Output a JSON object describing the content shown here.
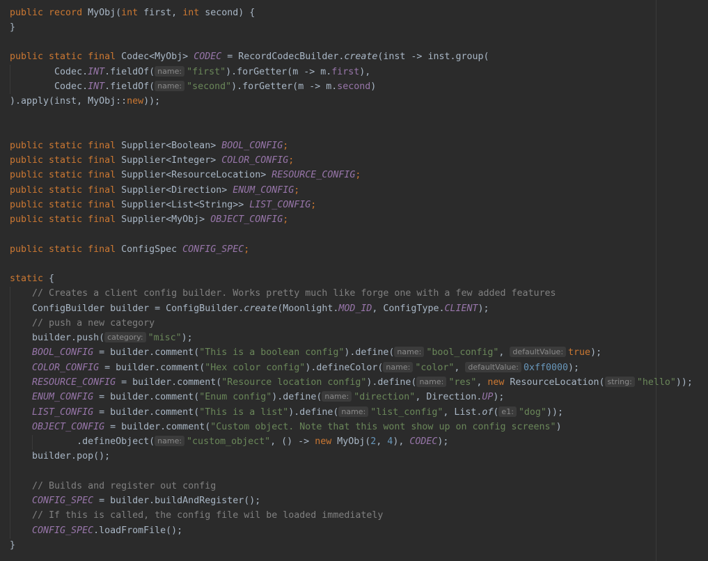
{
  "lines": [
    [
      {
        "t": "public record ",
        "c": "kw"
      },
      {
        "t": "MyObj(",
        "c": "plain"
      },
      {
        "t": "int ",
        "c": "kw"
      },
      {
        "t": "first, ",
        "c": "plain"
      },
      {
        "t": "int ",
        "c": "kw"
      },
      {
        "t": "second) {",
        "c": "plain"
      }
    ],
    [
      {
        "t": "}",
        "c": "plain"
      }
    ],
    [],
    [
      {
        "t": "public static final ",
        "c": "kw"
      },
      {
        "t": "Codec<MyObj> ",
        "c": "plain"
      },
      {
        "t": "CODEC",
        "c": "fld"
      },
      {
        "t": " = RecordCodecBuilder.",
        "c": "plain"
      },
      {
        "t": "create",
        "c": "mth"
      },
      {
        "t": "(inst -> inst.group(",
        "c": "plain"
      }
    ],
    [
      {
        "t": "        Codec.",
        "c": "plain"
      },
      {
        "t": "INT",
        "c": "fld"
      },
      {
        "t": ".fieldOf(",
        "c": "plain"
      },
      {
        "h": "name:"
      },
      {
        "t": "\"first\"",
        "c": "str"
      },
      {
        "t": ").forGetter(m -> m.",
        "c": "plain"
      },
      {
        "t": "first",
        "c": "mem"
      },
      {
        "t": "),",
        "c": "plain"
      }
    ],
    [
      {
        "t": "        Codec.",
        "c": "plain"
      },
      {
        "t": "INT",
        "c": "fld"
      },
      {
        "t": ".fieldOf(",
        "c": "plain"
      },
      {
        "h": "name:"
      },
      {
        "t": "\"second\"",
        "c": "str"
      },
      {
        "t": ").forGetter(m -> m.",
        "c": "plain"
      },
      {
        "t": "second",
        "c": "mem"
      },
      {
        "t": ")",
        "c": "plain"
      }
    ],
    [
      {
        "t": ").apply(inst, MyObj::",
        "c": "plain"
      },
      {
        "t": "new",
        "c": "kw"
      },
      {
        "t": "));",
        "c": "plain"
      }
    ],
    [],
    [],
    [
      {
        "t": "public static final ",
        "c": "kw"
      },
      {
        "t": "Supplier<Boolean> ",
        "c": "plain"
      },
      {
        "t": "BOOL_CONFIG",
        "c": "fld"
      },
      {
        "t": ";",
        "c": "kw"
      }
    ],
    [
      {
        "t": "public static final ",
        "c": "kw"
      },
      {
        "t": "Supplier<Integer> ",
        "c": "plain"
      },
      {
        "t": "COLOR_CONFIG",
        "c": "fld"
      },
      {
        "t": ";",
        "c": "kw"
      }
    ],
    [
      {
        "t": "public static final ",
        "c": "kw"
      },
      {
        "t": "Supplier<ResourceLocation> ",
        "c": "plain"
      },
      {
        "t": "RESOURCE_CONFIG",
        "c": "fld"
      },
      {
        "t": ";",
        "c": "kw"
      }
    ],
    [
      {
        "t": "public static final ",
        "c": "kw"
      },
      {
        "t": "Supplier<Direction> ",
        "c": "plain"
      },
      {
        "t": "ENUM_CONFIG",
        "c": "fld"
      },
      {
        "t": ";",
        "c": "kw"
      }
    ],
    [
      {
        "t": "public static final ",
        "c": "kw"
      },
      {
        "t": "Supplier<List<String>> ",
        "c": "plain"
      },
      {
        "t": "LIST_CONFIG",
        "c": "fld"
      },
      {
        "t": ";",
        "c": "kw"
      }
    ],
    [
      {
        "t": "public static final ",
        "c": "kw"
      },
      {
        "t": "Supplier<MyObj> ",
        "c": "plain"
      },
      {
        "t": "OBJECT_CONFIG",
        "c": "fld"
      },
      {
        "t": ";",
        "c": "kw"
      }
    ],
    [],
    [
      {
        "t": "public static final ",
        "c": "kw"
      },
      {
        "t": "ConfigSpec ",
        "c": "plain"
      },
      {
        "t": "CONFIG_SPEC",
        "c": "fld"
      },
      {
        "t": ";",
        "c": "kw"
      }
    ],
    [],
    [
      {
        "t": "static ",
        "c": "kw"
      },
      {
        "t": "{",
        "c": "plain"
      }
    ],
    [
      {
        "t": "    // Creates a client config builder. Works pretty much like forge one with a few added features",
        "c": "cmt"
      }
    ],
    [
      {
        "t": "    ConfigBuilder builder = ConfigBuilder.",
        "c": "plain"
      },
      {
        "t": "create",
        "c": "mth"
      },
      {
        "t": "(Moonlight.",
        "c": "plain"
      },
      {
        "t": "MOD_ID",
        "c": "fld"
      },
      {
        "t": ", ConfigType.",
        "c": "plain"
      },
      {
        "t": "CLIENT",
        "c": "fld"
      },
      {
        "t": ");",
        "c": "plain"
      }
    ],
    [
      {
        "t": "    // push a new category",
        "c": "cmt"
      }
    ],
    [
      {
        "t": "    builder.push(",
        "c": "plain"
      },
      {
        "h": "category:"
      },
      {
        "t": "\"misc\"",
        "c": "str"
      },
      {
        "t": ");",
        "c": "plain"
      }
    ],
    [
      {
        "t": "    ",
        "c": "plain"
      },
      {
        "t": "BOOL_CONFIG",
        "c": "fld"
      },
      {
        "t": " = builder.comment(",
        "c": "plain"
      },
      {
        "t": "\"This is a boolean config\"",
        "c": "str"
      },
      {
        "t": ").define(",
        "c": "plain"
      },
      {
        "h": "name:"
      },
      {
        "t": "\"bool_config\"",
        "c": "str"
      },
      {
        "t": ", ",
        "c": "plain"
      },
      {
        "h": "defaultValue:"
      },
      {
        "t": "true",
        "c": "kw"
      },
      {
        "t": ");",
        "c": "plain"
      }
    ],
    [
      {
        "t": "    ",
        "c": "plain"
      },
      {
        "t": "COLOR_CONFIG",
        "c": "fld"
      },
      {
        "t": " = builder.comment(",
        "c": "plain"
      },
      {
        "t": "\"Hex color config\"",
        "c": "str"
      },
      {
        "t": ").defineColor(",
        "c": "plain"
      },
      {
        "h": "name:"
      },
      {
        "t": "\"color\"",
        "c": "str"
      },
      {
        "t": ", ",
        "c": "plain"
      },
      {
        "h": "defaultValue:"
      },
      {
        "t": "0xff0000",
        "c": "num"
      },
      {
        "t": ");",
        "c": "plain"
      }
    ],
    [
      {
        "t": "    ",
        "c": "plain"
      },
      {
        "t": "RESOURCE_CONFIG",
        "c": "fld"
      },
      {
        "t": " = builder.comment(",
        "c": "plain"
      },
      {
        "t": "\"Resource location config\"",
        "c": "str"
      },
      {
        "t": ").define(",
        "c": "plain"
      },
      {
        "h": "name:"
      },
      {
        "t": "\"res\"",
        "c": "str"
      },
      {
        "t": ", ",
        "c": "plain"
      },
      {
        "t": "new ",
        "c": "kw"
      },
      {
        "t": "ResourceLocation(",
        "c": "plain"
      },
      {
        "h": "string:"
      },
      {
        "t": "\"hello\"",
        "c": "str"
      },
      {
        "t": "));",
        "c": "plain"
      }
    ],
    [
      {
        "t": "    ",
        "c": "plain"
      },
      {
        "t": "ENUM_CONFIG",
        "c": "fld"
      },
      {
        "t": " = builder.comment(",
        "c": "plain"
      },
      {
        "t": "\"Enum config\"",
        "c": "str"
      },
      {
        "t": ").define(",
        "c": "plain"
      },
      {
        "h": "name:"
      },
      {
        "t": "\"direction\"",
        "c": "str"
      },
      {
        "t": ", Direction.",
        "c": "plain"
      },
      {
        "t": "UP",
        "c": "fld"
      },
      {
        "t": ");",
        "c": "plain"
      }
    ],
    [
      {
        "t": "    ",
        "c": "plain"
      },
      {
        "t": "LIST_CONFIG",
        "c": "fld"
      },
      {
        "t": " = builder.comment(",
        "c": "plain"
      },
      {
        "t": "\"This is a list\"",
        "c": "str"
      },
      {
        "t": ").define(",
        "c": "plain"
      },
      {
        "h": "name:"
      },
      {
        "t": "\"list_config\"",
        "c": "str"
      },
      {
        "t": ", List.",
        "c": "plain"
      },
      {
        "t": "of",
        "c": "mth"
      },
      {
        "t": "(",
        "c": "plain"
      },
      {
        "h": "e1:"
      },
      {
        "t": "\"dog\"",
        "c": "str"
      },
      {
        "t": "));",
        "c": "plain"
      }
    ],
    [
      {
        "t": "    ",
        "c": "plain"
      },
      {
        "t": "OBJECT_CONFIG",
        "c": "fld"
      },
      {
        "t": " = builder.comment(",
        "c": "plain"
      },
      {
        "t": "\"Custom object. Note that this wont show up on config screens\"",
        "c": "str"
      },
      {
        "t": ")",
        "c": "plain"
      }
    ],
    [
      {
        "t": "            .defineObject(",
        "c": "plain"
      },
      {
        "h": "name:"
      },
      {
        "t": "\"custom_object\"",
        "c": "str"
      },
      {
        "t": ", () -> ",
        "c": "plain"
      },
      {
        "t": "new ",
        "c": "kw"
      },
      {
        "t": "MyObj(",
        "c": "plain"
      },
      {
        "t": "2",
        "c": "num"
      },
      {
        "t": ", ",
        "c": "plain"
      },
      {
        "t": "4",
        "c": "num"
      },
      {
        "t": "), ",
        "c": "plain"
      },
      {
        "t": "CODEC",
        "c": "fld"
      },
      {
        "t": ");",
        "c": "plain"
      }
    ],
    [
      {
        "t": "    builder.pop();",
        "c": "plain"
      }
    ],
    [],
    [
      {
        "t": "    // Builds and register out config",
        "c": "cmt"
      }
    ],
    [
      {
        "t": "    ",
        "c": "plain"
      },
      {
        "t": "CONFIG_SPEC",
        "c": "fld"
      },
      {
        "t": " = builder.buildAndRegister();",
        "c": "plain"
      }
    ],
    [
      {
        "t": "    // If this is called, the config file wil be loaded immediately",
        "c": "cmt"
      }
    ],
    [
      {
        "t": "    ",
        "c": "plain"
      },
      {
        "t": "CONFIG_SPEC",
        "c": "fld"
      },
      {
        "t": ".loadFromFile();",
        "c": "plain"
      }
    ],
    [
      {
        "t": "}",
        "c": "plain"
      }
    ]
  ]
}
